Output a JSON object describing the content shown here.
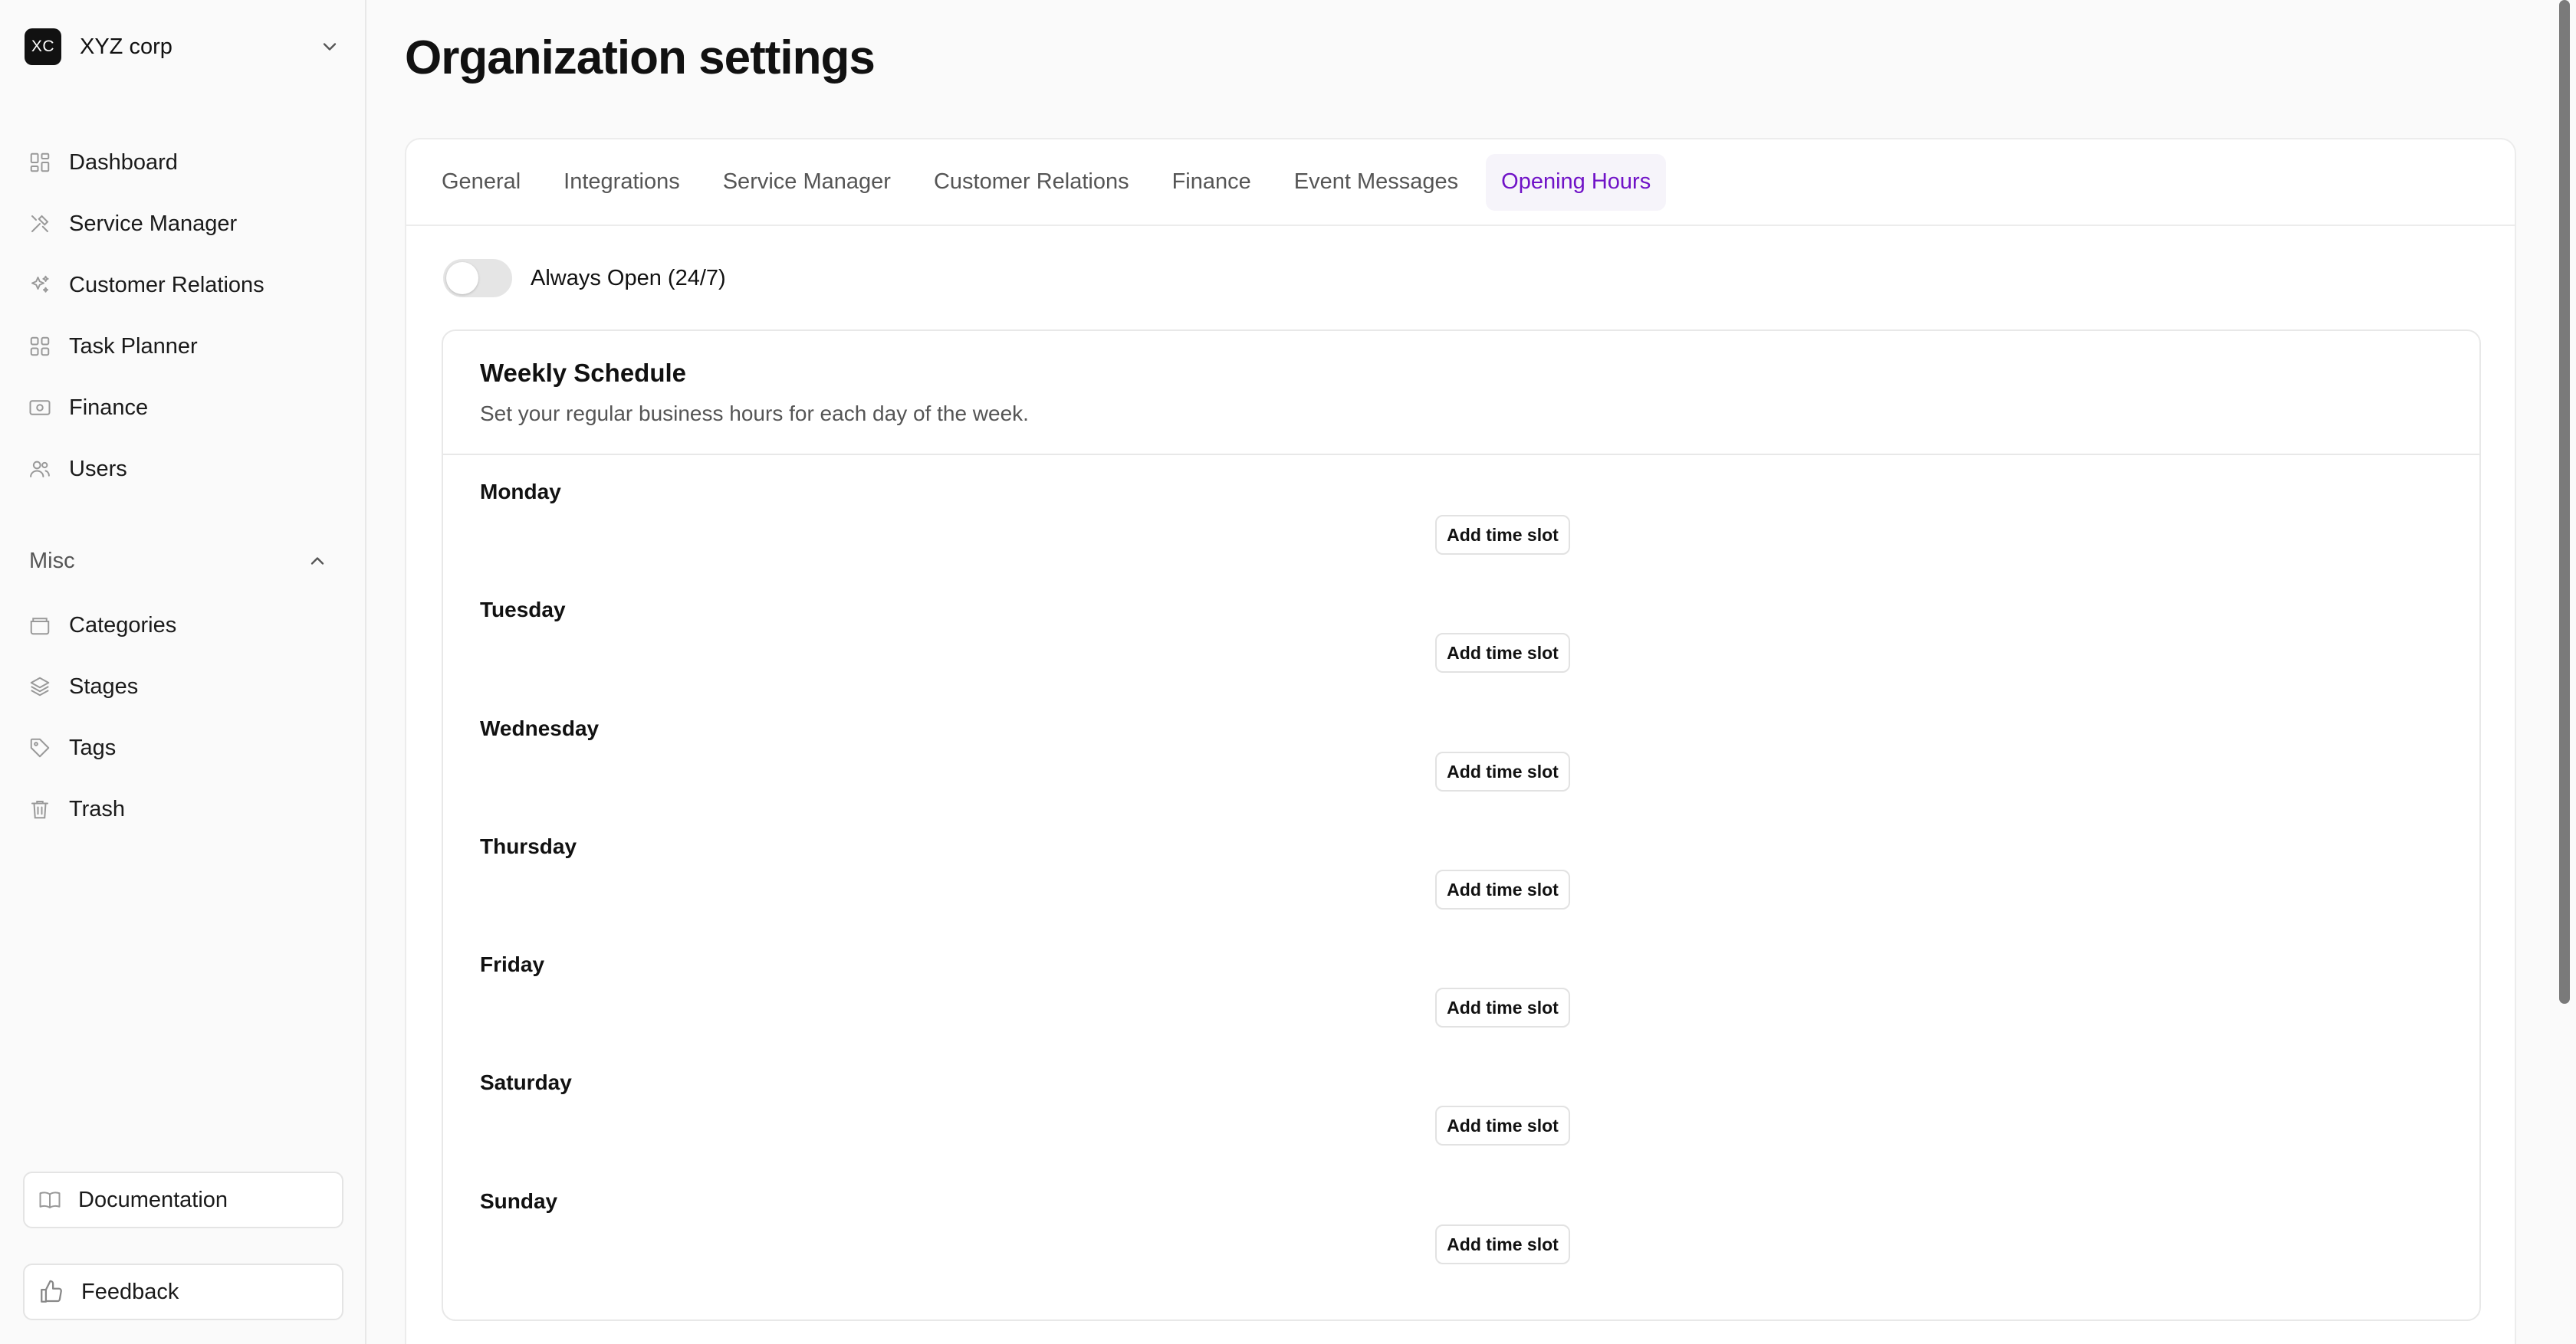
{
  "org": {
    "logo_text": "XC",
    "name": "XYZ corp"
  },
  "sidebar": {
    "items": [
      {
        "label": "Dashboard",
        "icon": "dashboard-icon"
      },
      {
        "label": "Service Manager",
        "icon": "tools-icon"
      },
      {
        "label": "Customer Relations",
        "icon": "sparkles-icon"
      },
      {
        "label": "Task Planner",
        "icon": "grid-icon"
      },
      {
        "label": "Finance",
        "icon": "banknote-icon"
      },
      {
        "label": "Users",
        "icon": "users-icon"
      }
    ],
    "misc_label": "Misc",
    "misc_items": [
      {
        "label": "Categories",
        "icon": "folder-icon"
      },
      {
        "label": "Stages",
        "icon": "layers-icon"
      },
      {
        "label": "Tags",
        "icon": "tag-icon"
      },
      {
        "label": "Trash",
        "icon": "trash-icon"
      }
    ],
    "documentation_label": "Documentation",
    "feedback_label": "Feedback"
  },
  "page": {
    "title": "Organization settings"
  },
  "tabs": [
    {
      "label": "General",
      "active": false
    },
    {
      "label": "Integrations",
      "active": false
    },
    {
      "label": "Service Manager",
      "active": false
    },
    {
      "label": "Customer Relations",
      "active": false
    },
    {
      "label": "Finance",
      "active": false
    },
    {
      "label": "Event Messages",
      "active": false
    },
    {
      "label": "Opening Hours",
      "active": true
    }
  ],
  "always_open": {
    "label": "Always Open (24/7)",
    "enabled": false
  },
  "schedule": {
    "title": "Weekly Schedule",
    "subtitle": "Set your regular business hours for each day of the week.",
    "add_label": "Add time slot",
    "days": [
      "Monday",
      "Tuesday",
      "Wednesday",
      "Thursday",
      "Friday",
      "Saturday",
      "Sunday"
    ]
  },
  "colors": {
    "accent": "#7012c7",
    "active_tab_bg": "#f6f4fa"
  }
}
